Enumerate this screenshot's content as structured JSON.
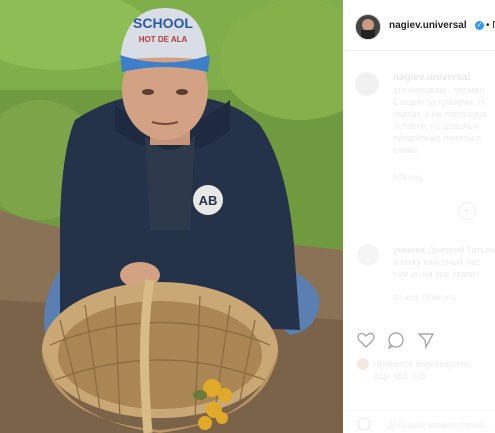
{
  "header": {
    "username": "nagiev.universal",
    "follow_prefix": "• П"
  },
  "caption": {
    "username": "nagiev.universal",
    "lines": [
      "это называю - термал",
      "Сходил за грибами. Н",
      "хватит, а не пососкура",
      "Устаёте, но довольн",
      "продолжаю лечиться",
      "схеме."
    ],
    "time": "109 нед."
  },
  "comment": {
    "username": "умника",
    "lines": [
      "Дмитрий Татьяна про",
      "а вижу классный лес",
      "там их на все хватит"
    ],
    "meta": "90 нед.   Ответить"
  },
  "likes": {
    "liked_by": "Нравится angelikayzmo",
    "count": "еще 481 308"
  },
  "add_comment": {
    "placeholder": "Добавьте комментарий..."
  },
  "photo": {
    "cap_text_top": "SCHOOL",
    "cap_text_bottom": "HOT DE ALA",
    "vest_logo": "AB"
  }
}
